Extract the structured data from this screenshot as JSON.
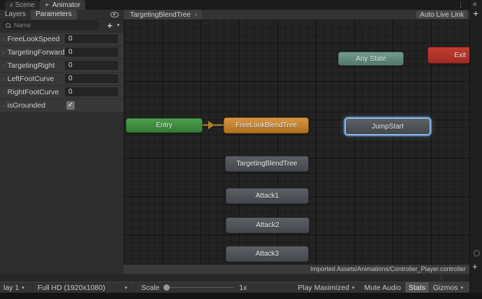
{
  "tab_bar": {
    "tabs": [
      {
        "label": "Scene"
      },
      {
        "label": "Animator"
      }
    ],
    "active_tab": "Animator"
  },
  "left_panel": {
    "tabs": [
      {
        "label": "Layers"
      },
      {
        "label": "Parameters"
      }
    ],
    "active_tab": "Parameters",
    "search": {
      "placeholder": "Name"
    },
    "parameters": [
      {
        "name": "FreeLookSpeed",
        "value": "0"
      },
      {
        "name": "TargetingForward",
        "value": "0"
      },
      {
        "name": "TargetingRight",
        "value": "0"
      },
      {
        "name": "LeftFootCurve",
        "value": "0"
      },
      {
        "name": "RightFootCurve",
        "value": "0"
      },
      {
        "name": "isGrounded",
        "checked": true
      }
    ]
  },
  "graph": {
    "breadcrumb": "TargetingBlendTree",
    "auto_live_link_label": "Auto Live Link",
    "nodes": {
      "any_state": {
        "label": "Any State",
        "color": "#628f7e"
      },
      "exit": {
        "label": "Exit",
        "color": "#b23329"
      },
      "entry": {
        "label": "Entry",
        "color": "#3f8c40"
      },
      "freelook_blendtree": {
        "label": "FreeLookBlendTree",
        "color": "#c48331"
      },
      "jumpstart": {
        "label": "JumpStart",
        "color": "#50545a",
        "selected": true
      },
      "targeting_blendtree": {
        "label": "TargetingBlendTree",
        "color": "#50545a"
      },
      "attack1": {
        "label": "Attack1",
        "color": "#50545a"
      },
      "attack2": {
        "label": "Attack2",
        "color": "#50545a"
      },
      "attack3": {
        "label": "Attack3",
        "color": "#50545a"
      }
    },
    "transition_color": "#b07c28",
    "selection_color": "#6fa8dc",
    "status_text": "Imported Assets/Animations/Controller_Player.controller"
  },
  "game_toolbar": {
    "display_label": "lay 1",
    "resolution_label": "Full HD (1920x1080)",
    "scale_label": "Scale",
    "scale_value": "1x",
    "play_maximized_label": "Play Maximized",
    "mute_audio_label": "Mute Audio",
    "stats_label": "Stats",
    "gizmos_label": "Gizmos"
  },
  "icons": {
    "scene_tab": "#",
    "animator_tab": "►",
    "dropdown_arrow": "▾",
    "breadcrumb_chevron": "›",
    "plus": "+",
    "kebab": "⋮",
    "hamburger": "≡",
    "drag_handle": "=",
    "check": "✓"
  }
}
